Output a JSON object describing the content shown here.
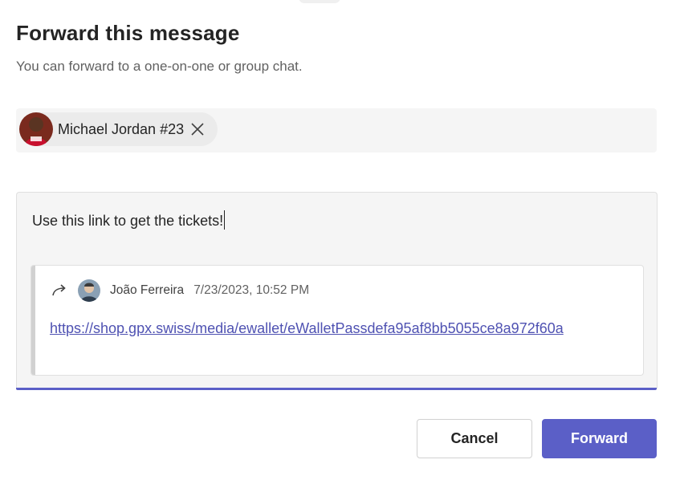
{
  "dialog": {
    "title": "Forward this message",
    "subtitle": "You can forward to a one-on-one or group chat."
  },
  "recipients": [
    {
      "name": "Michael Jordan #23",
      "avatar_icon": "person-avatar",
      "remove_icon": "close-icon"
    }
  ],
  "compose": {
    "message": "Use this link to get the tickets!",
    "quoted": {
      "icon": "forward-arrow-icon",
      "author": "João Ferreira",
      "timestamp": "7/23/2023, 10:52 PM",
      "link": "https://shop.gpx.swiss/media/ewallet/eWalletPassdefa95af8bb5055ce8a972f60a"
    }
  },
  "actions": {
    "cancel_label": "Cancel",
    "forward_label": "Forward"
  },
  "colors": {
    "accent": "#5b5fc7",
    "link": "#4f52b2",
    "field_bg": "#f5f5f5"
  }
}
